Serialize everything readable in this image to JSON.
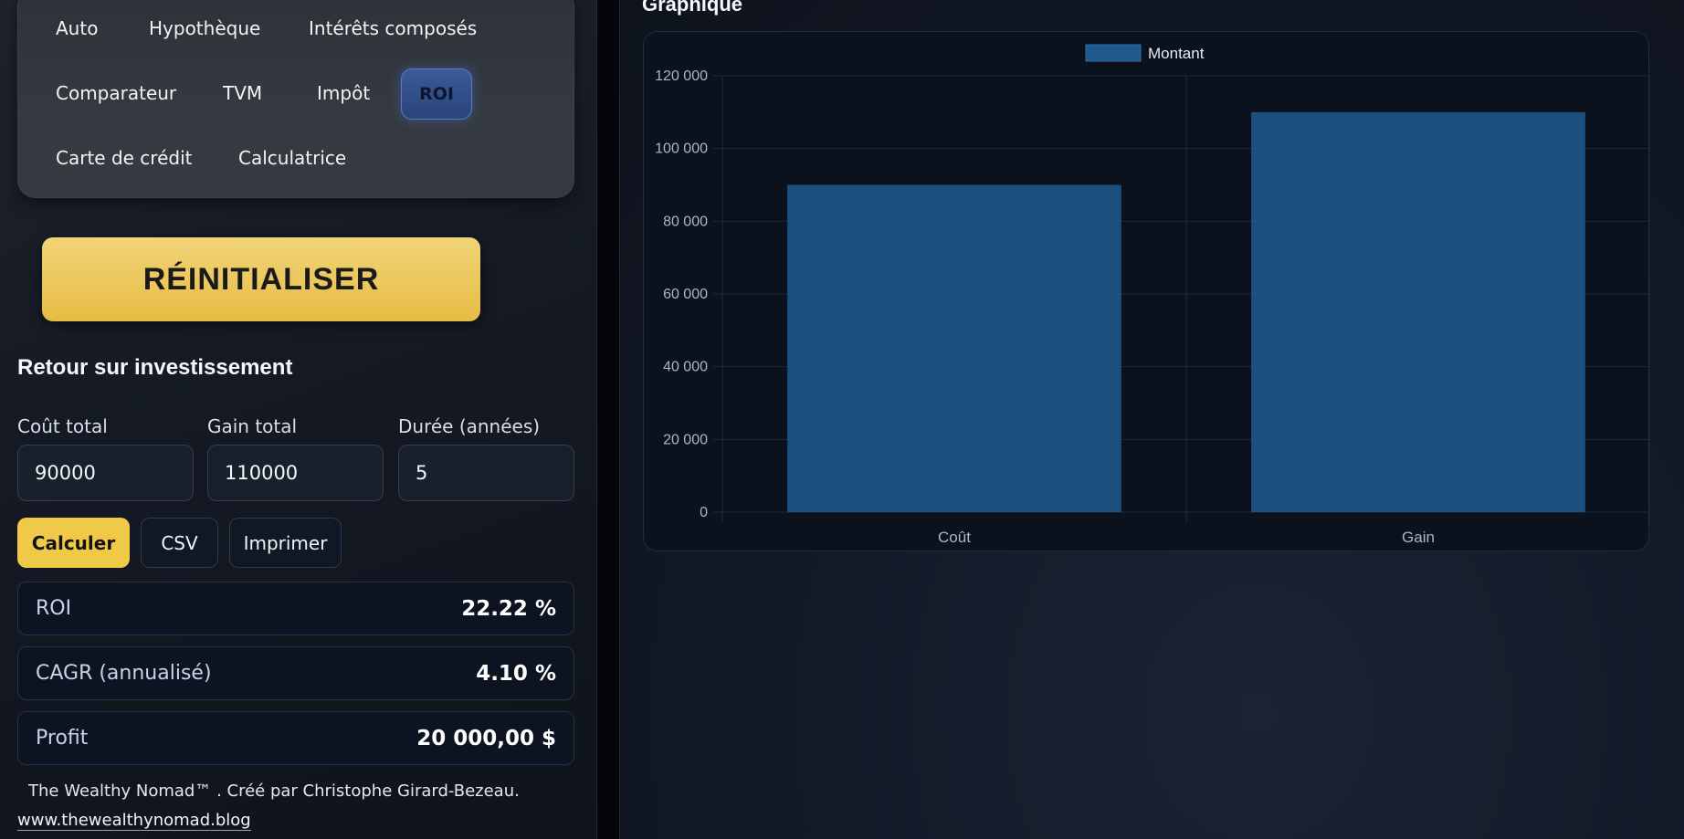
{
  "nav": {
    "items": [
      {
        "label": "Auto",
        "active": false
      },
      {
        "label": "Hypothèque",
        "active": false
      },
      {
        "label": "Intérêts composés",
        "active": false
      },
      {
        "label": "Comparateur",
        "active": false
      },
      {
        "label": "TVM",
        "active": false
      },
      {
        "label": "Impôt",
        "active": false
      },
      {
        "label": "ROI",
        "active": true
      },
      {
        "label": "Carte de crédit",
        "active": false
      },
      {
        "label": "Calculatrice",
        "active": false
      }
    ]
  },
  "reset_label": "RÉINITIALISER",
  "section_title": "Retour sur investissement",
  "fields": [
    {
      "label": "Coût total",
      "value": "90000"
    },
    {
      "label": "Gain total",
      "value": "110000"
    },
    {
      "label": "Durée (années)",
      "value": "5"
    }
  ],
  "actions": {
    "calculate": "Calculer",
    "csv": "CSV",
    "print": "Imprimer"
  },
  "results": [
    {
      "label": "ROI",
      "value": "22.22 %"
    },
    {
      "label": "CAGR (annualisé)",
      "value": "4.10 %"
    },
    {
      "label": "Profit",
      "value": "20 000,00 $"
    }
  ],
  "footer": {
    "credit": "The Wealthy Nomad™  .  Créé par Christophe Girard-Bezeau.",
    "link": "www.thewealthynomad.blog"
  },
  "chart_title": "Graphique",
  "colors": {
    "accent_gold": "#f1c949",
    "active_nav": "#2b4479",
    "bar": "#1f5a8f"
  },
  "chart_data": {
    "type": "bar",
    "categories": [
      "Coût",
      "Gain"
    ],
    "series": [
      {
        "name": "Montant",
        "values": [
          90000,
          110000
        ]
      }
    ],
    "ylim": [
      0,
      120000
    ],
    "yticks": [
      0,
      20000,
      40000,
      60000,
      80000,
      100000,
      120000
    ],
    "ytick_labels": [
      "0",
      "20 000",
      "40 000",
      "60 000",
      "80 000",
      "100 000",
      "120 000"
    ],
    "legend_position": "top-center",
    "grid": true
  }
}
